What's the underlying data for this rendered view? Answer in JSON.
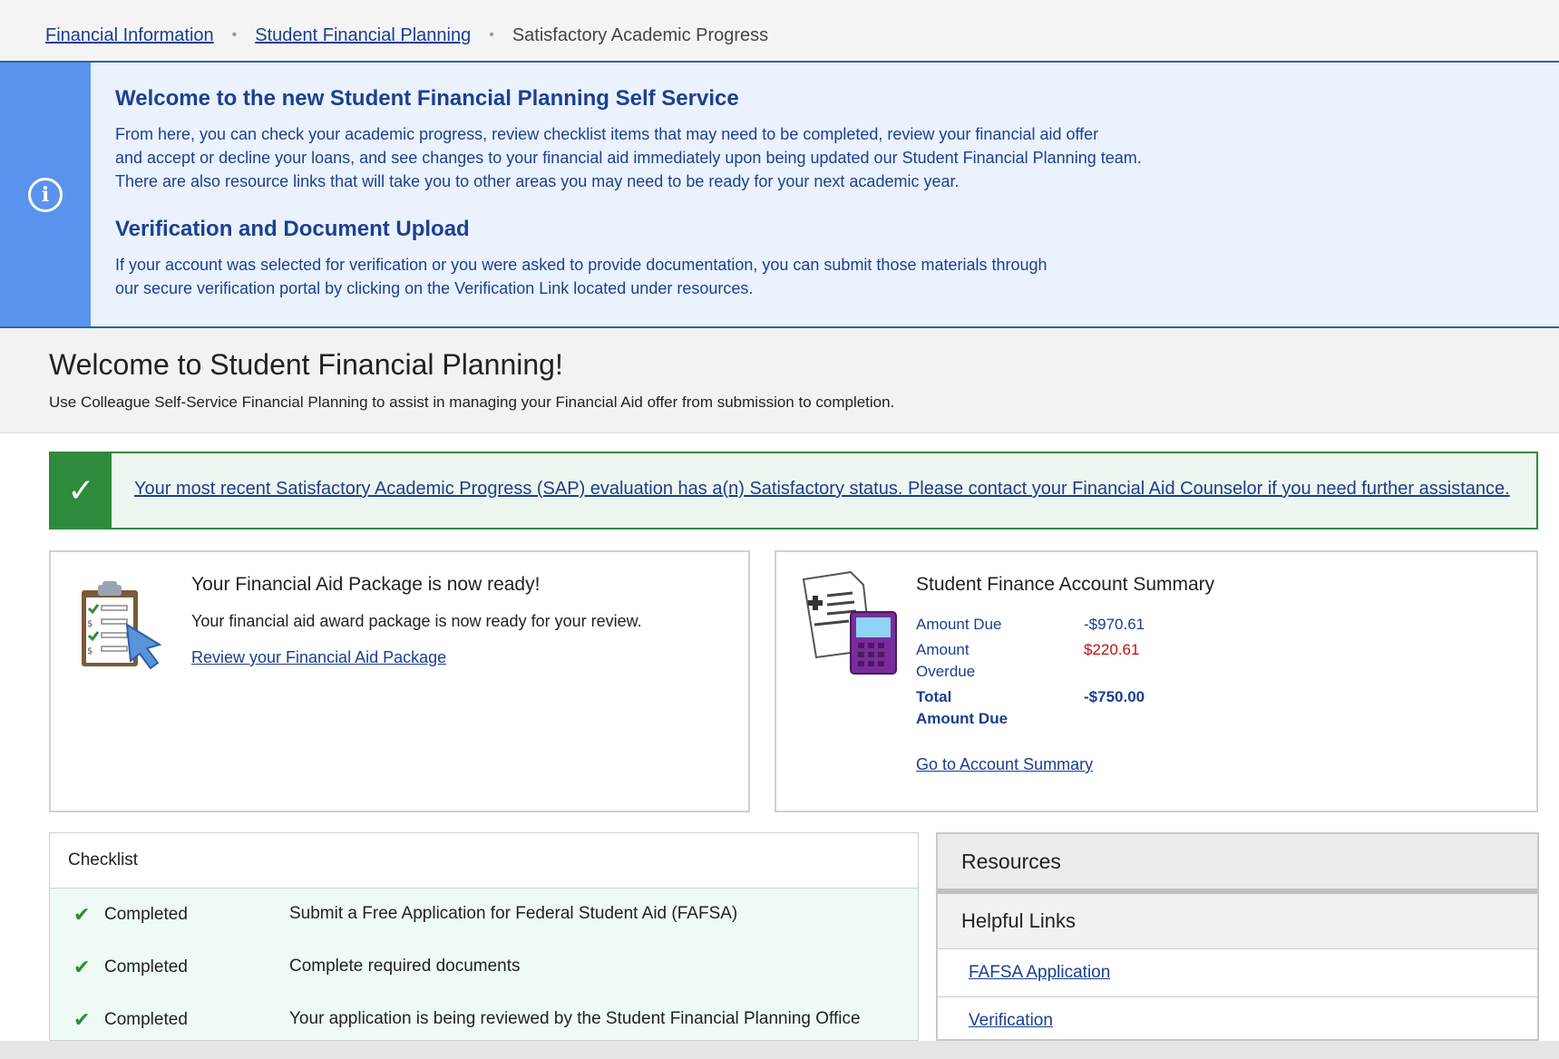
{
  "breadcrumb": {
    "items": [
      "Financial Information",
      "Student Financial Planning"
    ],
    "current": "Satisfactory Academic Progress"
  },
  "info_banner": {
    "icon": "info-icon",
    "title1": "Welcome to the new Student Financial Planning Self Service",
    "para1_line1": "From here, you can check your academic progress, review checklist items that may need to be completed, review your financial aid offer",
    "para1_line2": "and accept or decline your loans, and see changes to your financial aid immediately upon being updated our Student Financial Planning team.",
    "para1_line3": "There are also resource links that will take you to other areas you may need to be ready for your next academic year.",
    "title2": "Verification and Document Upload",
    "para2_line1": "If your account was selected for verification or you were asked to provide documentation, you can submit those materials through",
    "para2_line2": "our secure verification portal by clicking on the Verification Link located under resources."
  },
  "welcome": {
    "title": "Welcome to Student Financial Planning!",
    "subtitle": "Use Colleague Self-Service Financial Planning to assist in managing your Financial Aid offer from submission to completion."
  },
  "sap_alert": {
    "icon": "checkmark-icon",
    "message": "Your most recent Satisfactory Academic Progress (SAP) evaluation has a(n) Satisfactory status. Please contact your Financial Aid Counselor if you need further assistance."
  },
  "aid_card": {
    "icon": "clipboard-icon",
    "title": "Your Financial Aid Package is now ready!",
    "desc": "Your financial aid award package is now ready for your review.",
    "link": "Review your Financial Aid Package"
  },
  "account_card": {
    "icon": "document-calculator-icon",
    "title": "Student Finance Account Summary",
    "rows": [
      {
        "label": "Amount Due",
        "value": "-$970.61"
      },
      {
        "label_line1": "Amount",
        "label_line2": "Overdue",
        "value": "$220.61"
      },
      {
        "label_line1": "Total",
        "label_line2": "Amount Due",
        "value": "-$750.00"
      }
    ],
    "link": "Go to Account Summary",
    "colors": {
      "overdue": "#c01010",
      "accent": "#1a3e8f"
    }
  },
  "checklist": {
    "title": "Checklist",
    "items": [
      {
        "status": "Completed",
        "task": "Submit a Free Application for Federal Student Aid (FAFSA)"
      },
      {
        "status": "Completed",
        "task": "Complete required documents"
      },
      {
        "status": "Completed",
        "task": "Your application is being reviewed by the Student Financial Planning Office"
      }
    ]
  },
  "resources": {
    "title": "Resources",
    "subtitle": "Helpful Links",
    "links": [
      "FAFSA Application",
      "Verification"
    ]
  }
}
